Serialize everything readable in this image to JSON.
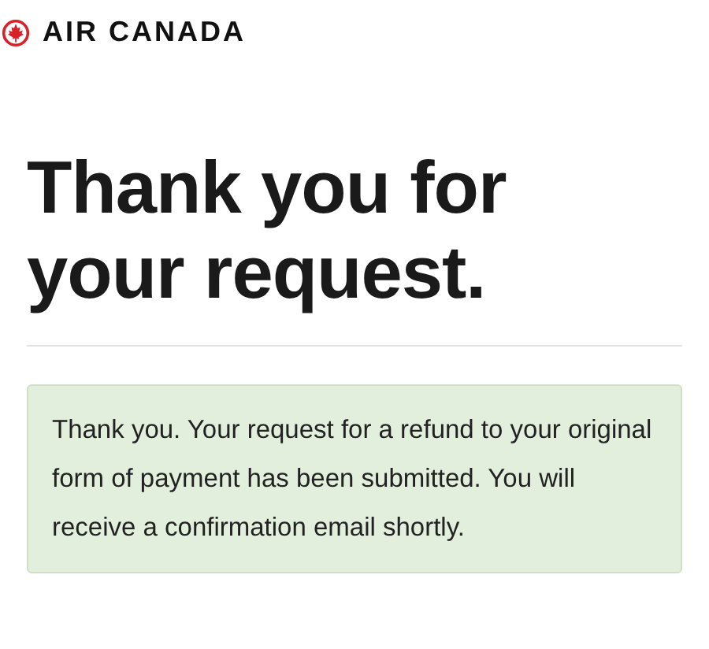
{
  "header": {
    "logo_text": "AIR CANADA"
  },
  "heading": "Thank you for your request.",
  "message": "Thank you. Your request for a refund to your original form of payment has been submitted. You will receive a confirmation email shortly."
}
